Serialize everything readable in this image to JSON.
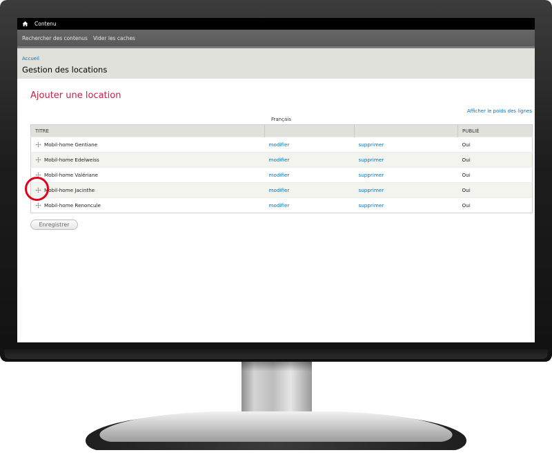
{
  "toolbar": {
    "home_icon": "home-icon",
    "menu_label": "Contenu"
  },
  "shortcuts": [
    {
      "label": "Rechercher des contenus"
    },
    {
      "label": "Vider les caches"
    }
  ],
  "header": {
    "breadcrumb": "Accueil",
    "title": "Gestion des locations"
  },
  "content": {
    "heading": "Ajouter une location",
    "language_label": "Français",
    "weights_link": "Afficher le poids des lignes"
  },
  "table": {
    "columns": [
      "Titre",
      "",
      "",
      "Publié"
    ],
    "rows": [
      {
        "title": "Mobil-home Gentiane",
        "edit": "modifier",
        "delete": "supprimer",
        "published": "Oui"
      },
      {
        "title": "Mobil-home Edelweiss",
        "edit": "modifier",
        "delete": "supprimer",
        "published": "Oui"
      },
      {
        "title": "Mobil-home Valériane",
        "edit": "modifier",
        "delete": "supprimer",
        "published": "Oui"
      },
      {
        "title": "Mobil-home Jacinthe",
        "edit": "modifier",
        "delete": "supprimer",
        "published": "Oui"
      },
      {
        "title": "Mobil-home Renoncule",
        "edit": "modifier",
        "delete": "supprimer",
        "published": "Oui"
      }
    ]
  },
  "actions": {
    "save_label": "Enregistrer"
  },
  "colors": {
    "accent_title": "#c81d42",
    "link": "#0074bd",
    "highlight": "#e3001b"
  }
}
